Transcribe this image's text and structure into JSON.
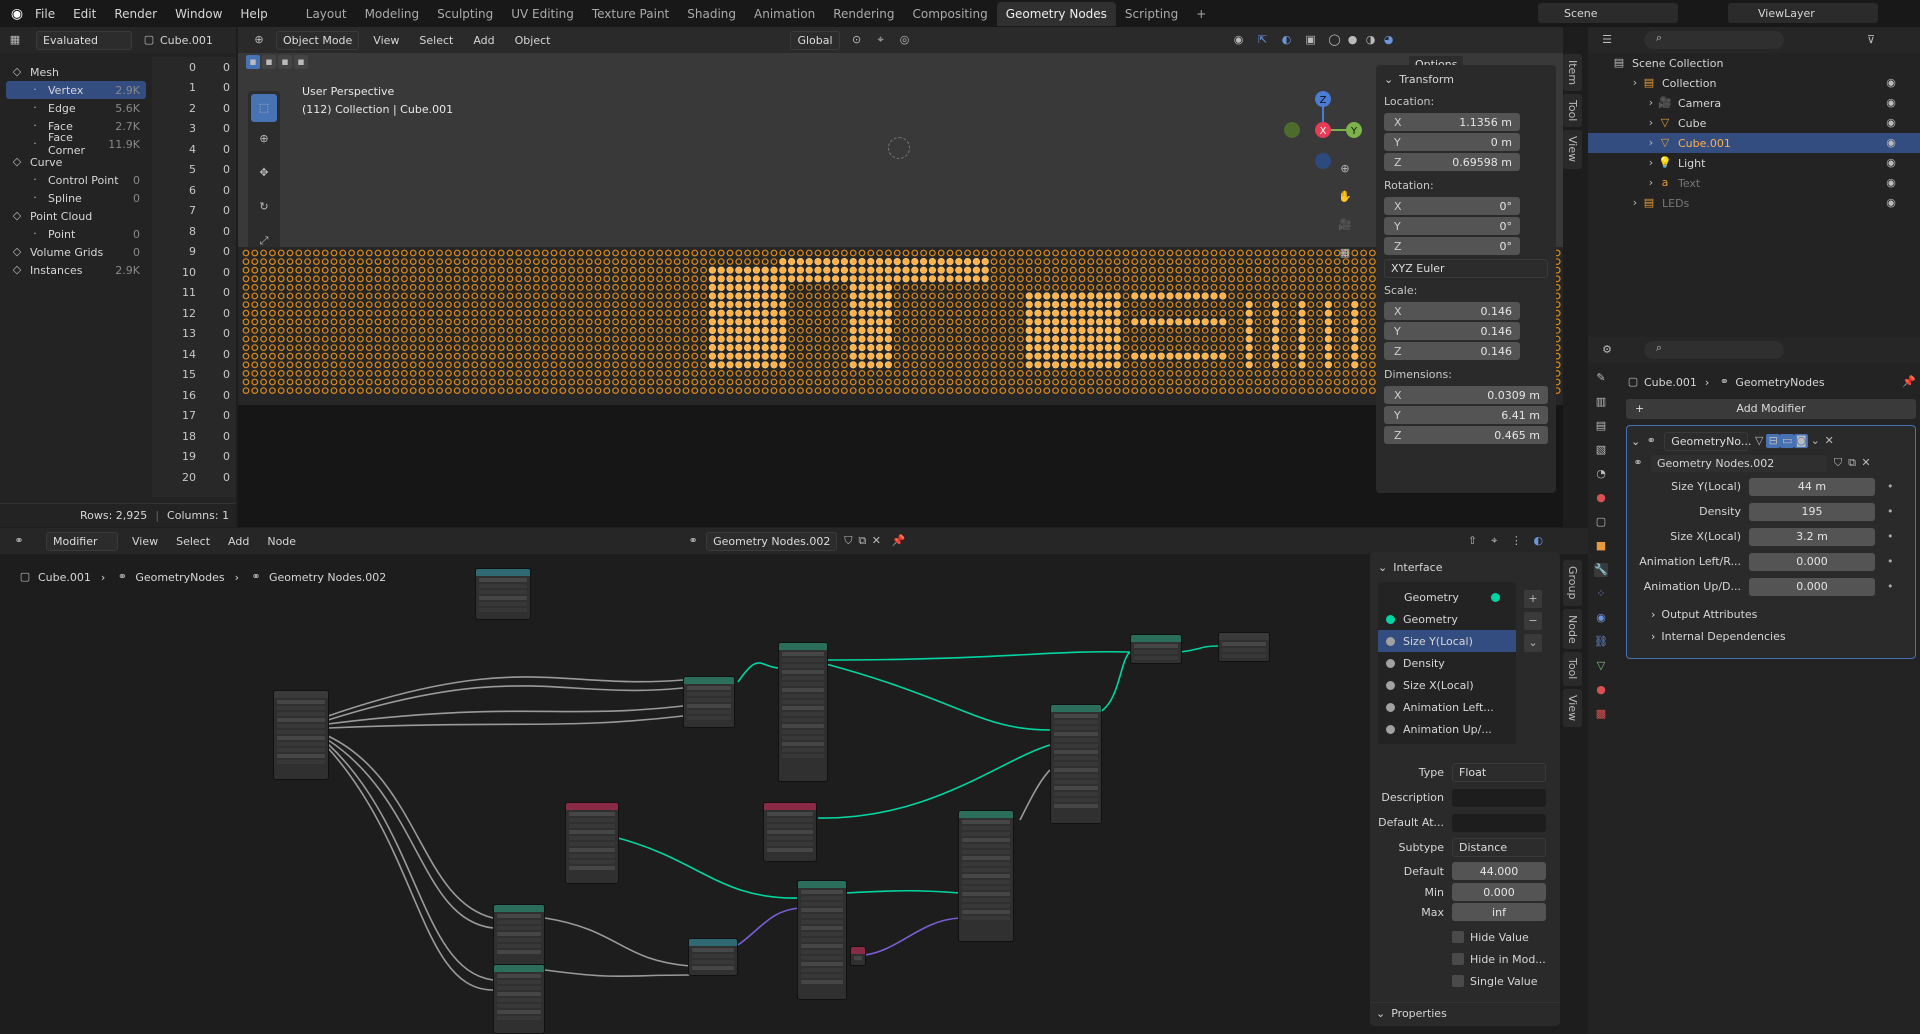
{
  "app": {
    "logo_icon": "blender-logo-icon"
  },
  "menu": [
    "File",
    "Edit",
    "Render",
    "Window",
    "Help"
  ],
  "workspaces": [
    "Layout",
    "Modeling",
    "Sculpting",
    "UV Editing",
    "Texture Paint",
    "Shading",
    "Animation",
    "Rendering",
    "Compositing",
    "Geometry Nodes",
    "Scripting"
  ],
  "active_workspace": "Geometry Nodes",
  "scene": {
    "name": "Scene",
    "viewlayer": "ViewLayer"
  },
  "spreadsheet": {
    "mode": "Evaluated",
    "object": "Cube.001",
    "domains": [
      {
        "name": "Mesh",
        "count": "",
        "header": true
      },
      {
        "name": "Vertex",
        "count": "2.9K",
        "selected": true
      },
      {
        "name": "Edge",
        "count": "5.6K"
      },
      {
        "name": "Face",
        "count": "2.7K"
      },
      {
        "name": "Face Corner",
        "count": "11.9K"
      },
      {
        "name": "Curve",
        "count": "",
        "header": true
      },
      {
        "name": "Control Point",
        "count": "0"
      },
      {
        "name": "Spline",
        "count": "0"
      },
      {
        "name": "Point Cloud",
        "count": "",
        "header": true
      },
      {
        "name": "Point",
        "count": "0"
      },
      {
        "name": "Volume Grids",
        "count": "0",
        "header": true
      },
      {
        "name": "Instances",
        "count": "2.9K",
        "header": true
      }
    ],
    "rows": [
      "0",
      "1",
      "2",
      "3",
      "4",
      "5",
      "6",
      "7",
      "8",
      "9",
      "10",
      "11",
      "12",
      "13",
      "14",
      "15",
      "16",
      "17",
      "18",
      "19",
      "20"
    ],
    "col": [
      "0",
      "0",
      "0",
      "0",
      "0",
      "0",
      "0",
      "0",
      "0",
      "0",
      "0",
      "0",
      "0",
      "0",
      "0",
      "0",
      "0",
      "0",
      "0",
      "0",
      "0"
    ],
    "status_rows": "Rows: 2,925",
    "status_cols": "Columns: 1"
  },
  "viewport": {
    "mode": "Object Mode",
    "menus": [
      "View",
      "Select",
      "Add",
      "Object"
    ],
    "orientation": "Global",
    "options": "Options",
    "perspective": "User Perspective",
    "collection_info": "(112) Collection | Cube.001",
    "gizmo": {
      "x": "X",
      "y": "Y",
      "z": "Z"
    }
  },
  "transform": {
    "title": "Transform",
    "location_label": "Location:",
    "location": {
      "x": "1.1356 m",
      "y": "0 m",
      "z": "0.69598 m"
    },
    "rotation_label": "Rotation:",
    "rotation": {
      "x": "0°",
      "y": "0°",
      "z": "0°"
    },
    "rotation_mode": "XYZ Euler",
    "scale_label": "Scale:",
    "scale": {
      "x": "0.146",
      "y": "0.146",
      "z": "0.146"
    },
    "dimensions_label": "Dimensions:",
    "dimensions": {
      "x": "0.0309 m",
      "y": "6.41 m",
      "z": "0.465 m"
    },
    "axes": {
      "x": "X",
      "y": "Y",
      "z": "Z"
    }
  },
  "side_tabs_viewport": [
    "Item",
    "Tool",
    "View"
  ],
  "outliner": {
    "root": "Scene Collection",
    "items": [
      {
        "name": "Collection",
        "indent": 1
      },
      {
        "name": "Camera",
        "indent": 2
      },
      {
        "name": "Cube",
        "indent": 2
      },
      {
        "name": "Cube.001",
        "indent": 2,
        "selected": true
      },
      {
        "name": "Light",
        "indent": 2
      },
      {
        "name": "Text",
        "indent": 2,
        "dim": true
      },
      {
        "name": "LEDs",
        "indent": 1,
        "dim": true
      }
    ]
  },
  "properties": {
    "breadcrumb_obj": "Cube.001",
    "breadcrumb_mod": "GeometryNodes",
    "add_modifier": "Add Modifier",
    "modifier_name": "GeometryNo...",
    "node_group": "Geometry Nodes.002",
    "inputs": [
      {
        "label": "Size Y(Local)",
        "value": "44 m"
      },
      {
        "label": "Density",
        "value": "195"
      },
      {
        "label": "Size X(Local)",
        "value": "3.2 m"
      },
      {
        "label": "Animation Left/R...",
        "value": "0.000"
      },
      {
        "label": "Animation Up/D...",
        "value": "0.000"
      }
    ],
    "output_attrs": "Output Attributes",
    "internal_deps": "Internal Dependencies"
  },
  "node_editor": {
    "editor": "Modifier",
    "menus": [
      "View",
      "Select",
      "Add",
      "Node"
    ],
    "group_name": "Geometry Nodes.002",
    "breadcrumb": [
      "Cube.001",
      "GeometryNodes",
      "Geometry Nodes.002"
    ]
  },
  "interface_panel": {
    "title": "Interface",
    "items": [
      {
        "name": "Geometry",
        "color": "#00d6a3",
        "output": true
      },
      {
        "name": "Geometry",
        "color": "#00d6a3"
      },
      {
        "name": "Size Y(Local)",
        "color": "#a1a1a1",
        "selected": true
      },
      {
        "name": "Density",
        "color": "#a1a1a1"
      },
      {
        "name": "Size X(Local)",
        "color": "#a1a1a1"
      },
      {
        "name": "Animation Left...",
        "color": "#a1a1a1"
      },
      {
        "name": "Animation Up/...",
        "color": "#a1a1a1"
      }
    ],
    "type_label": "Type",
    "type": "Float",
    "desc_label": "Description",
    "desc": "",
    "default_attr_label": "Default At...",
    "default_attr": "",
    "subtype_label": "Subtype",
    "subtype": "Distance",
    "default_label": "Default",
    "default": "44.000",
    "min_label": "Min",
    "min": "0.000",
    "max_label": "Max",
    "max": "inf",
    "hide_value": "Hide Value",
    "hide_in_mod": "Hide in Mod...",
    "single_value": "Single Value",
    "properties": "Properties"
  },
  "side_tabs_nodes": [
    "Group",
    "Node",
    "Tool",
    "View"
  ],
  "colors": {
    "accent": "#4772b3",
    "selected_row": "#334d80",
    "geometry_socket": "#00d6a3",
    "led_orange": "#ff9a2e"
  }
}
